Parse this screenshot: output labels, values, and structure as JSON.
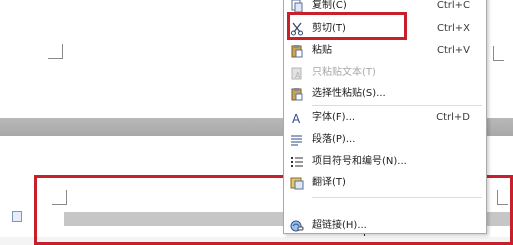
{
  "context_menu": {
    "items": [
      {
        "label": "复制(C)",
        "shortcut": "Ctrl+C",
        "icon": "copy-icon"
      },
      {
        "label": "剪切(T)",
        "shortcut": "Ctrl+X",
        "icon": "scissors-icon"
      },
      {
        "label": "粘贴",
        "shortcut": "Ctrl+V",
        "icon": "paste-icon"
      },
      {
        "label": "只粘贴文本(T)",
        "shortcut": "",
        "icon": "paste-text-icon",
        "disabled": true
      },
      {
        "label": "选择性粘贴(S)...",
        "shortcut": "",
        "icon": "paste-special-icon"
      },
      {
        "label": "字体(F)...",
        "shortcut": "Ctrl+D",
        "icon": "font-icon"
      },
      {
        "label": "段落(P)...",
        "shortcut": "",
        "icon": "paragraph-icon"
      },
      {
        "label": "项目符号和编号(N)...",
        "shortcut": "",
        "icon": "bullet-list-icon"
      },
      {
        "label": "翻译(T)",
        "shortcut": "",
        "icon": "translate-icon"
      },
      {
        "label": "超链接(H)...",
        "shortcut": "",
        "icon": "hyperlink-icon"
      }
    ]
  },
  "colors": {
    "highlight": "#c8202a",
    "menu_border": "#a9a9a9",
    "disabled_text": "#a8a8a8"
  }
}
